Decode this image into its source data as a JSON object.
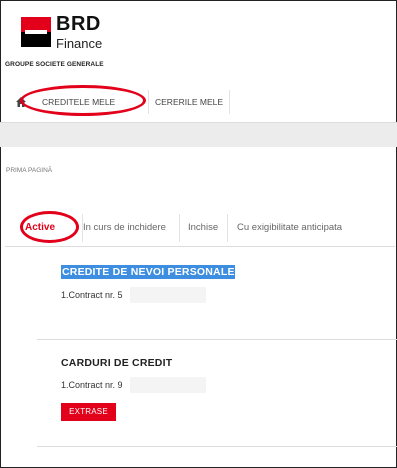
{
  "brand": {
    "name": "BRD",
    "sub": "Finance",
    "group": "GROUPE SOCIETE GENERALE",
    "accent": "#e2001a"
  },
  "topnav": {
    "items": [
      {
        "label": "CREDITELE MELE"
      },
      {
        "label": "CERERILE MELE"
      }
    ]
  },
  "breadcrumb": "PRIMA PAGINĂ",
  "tabs": [
    {
      "label": "Active",
      "active": true
    },
    {
      "label": "In curs de inchidere"
    },
    {
      "label": "Inchise"
    },
    {
      "label": "Cu exigibilitate anticipata"
    }
  ],
  "sections": [
    {
      "title": "CREDITE DE NEVOI PERSONALE",
      "contract": "1.Contract nr. 5"
    },
    {
      "title": "CARDURI DE CREDIT",
      "contract": "1.Contract nr. 9",
      "button": "EXTRASE"
    }
  ]
}
